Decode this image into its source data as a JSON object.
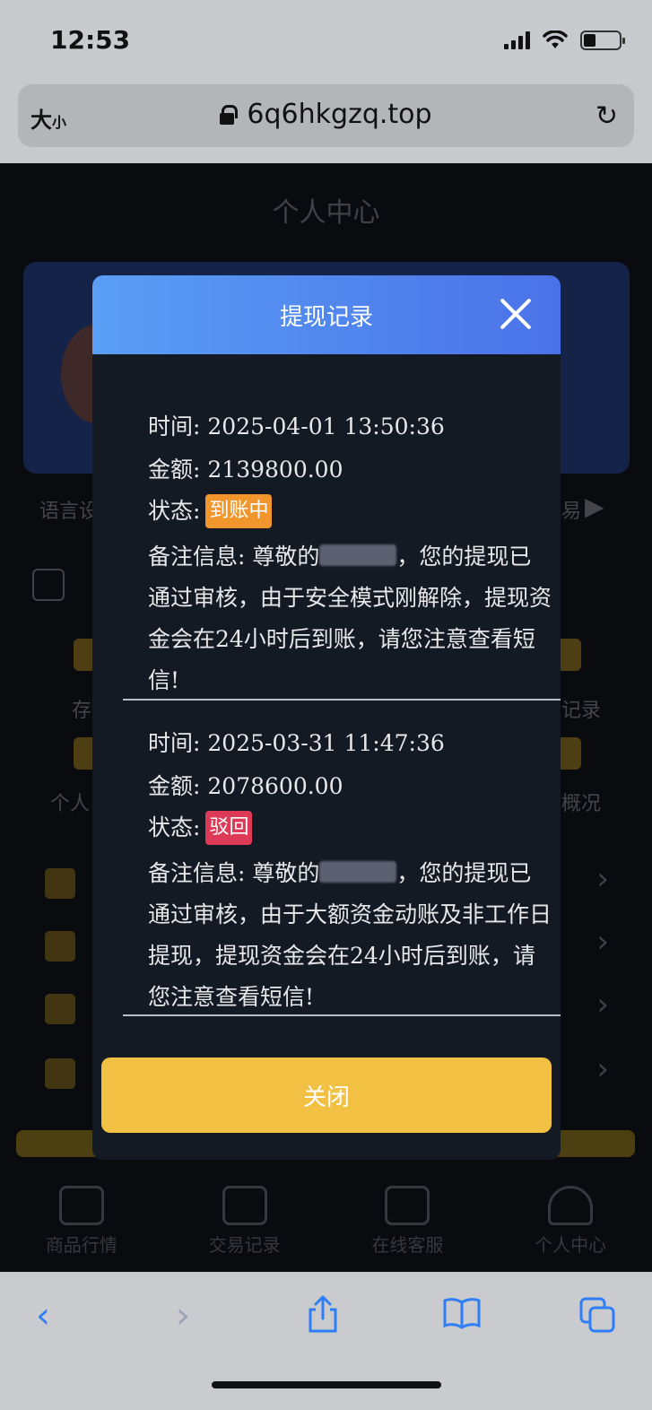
{
  "status_bar": {
    "time": "12:53"
  },
  "address_bar": {
    "text_size_big": "大",
    "text_size_small": "小",
    "url": "6q6hkgzq.top",
    "reload_icon": "reload-icon"
  },
  "app": {
    "page_title": "个人中心",
    "bg_language": "语言设",
    "bg_trade_arrow": "易",
    "bg_item_left_1": "存",
    "bg_item_right_1": "记录",
    "bg_item_left_2": "个人",
    "bg_item_right_2": "概况",
    "tabs": [
      "商品行情",
      "交易记录",
      "在线客服",
      "个人中心"
    ]
  },
  "modal": {
    "title": "提现记录",
    "records": [
      {
        "time_label": "时间:",
        "time": "2025-04-01 13:50:36",
        "amount_label": "金额:",
        "amount": "2139800.00",
        "status_label": "状态:",
        "status": "到账中",
        "note_label": "备注信息:",
        "note_prefix": "尊敬的",
        "note_suffix": "，您的提现已通过审核，由于安全模式刚解除，提现资金会在24小时后到账，请您注意查看短信!"
      },
      {
        "time_label": "时间:",
        "time": "2025-03-31 11:47:36",
        "amount_label": "金额:",
        "amount": "2078600.00",
        "status_label": "状态:",
        "status": "驳回",
        "note_label": "备注信息:",
        "note_prefix": "尊敬的",
        "note_suffix": "，您的提现已通过审核，由于大额资金动账及非工作日提现，提现资金会在24小时后到账，请您注意查看短信!"
      }
    ],
    "close_button": "关闭"
  },
  "colors": {
    "pending": "#f0962c",
    "rejected": "#dc3a57",
    "accent": "#f2c144",
    "header_start": "#5a9ef5",
    "header_end": "#4a72e8"
  }
}
